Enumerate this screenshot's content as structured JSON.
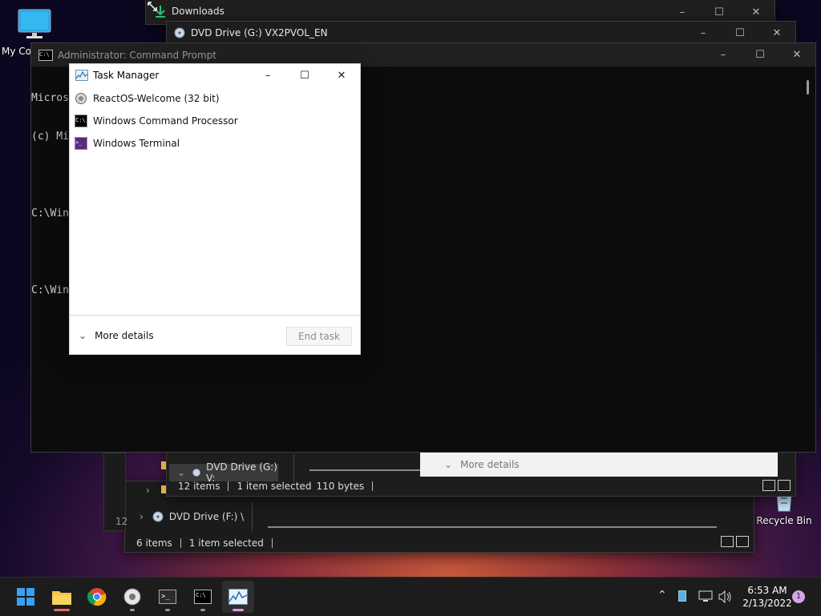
{
  "desktop": {
    "my_computer_label": "My Co",
    "recycle_bin_label": "Recycle Bin"
  },
  "downloads_window": {
    "title": "Downloads"
  },
  "dvd_g_window": {
    "title": "DVD Drive (G:) VX2PVOL_EN",
    "tree_item": "DVD Drive (G:) V:",
    "status_items": "12 items",
    "status_selected": "1 item selected",
    "status_size": "110 bytes",
    "more_details": "More details"
  },
  "back_window": {
    "tree_item": "DVD Drive (F:) \\",
    "status_items": "6 items",
    "status_selected": "1 item selected",
    "partial_count": "12"
  },
  "cmd_window": {
    "title": "Administrator: Command Prompt",
    "lines": [
      "Micros",
      "(c) Mi",
      "",
      "C:\\Win",
      "",
      "C:\\Win"
    ]
  },
  "task_manager": {
    "title": "Task Manager",
    "items": [
      {
        "label": "ReactOS-Welcome (32 bit)",
        "icon": "reactos-icon"
      },
      {
        "label": "Windows Command Processor",
        "icon": "cmd-icon"
      },
      {
        "label": "Windows Terminal",
        "icon": "terminal-icon"
      }
    ],
    "more_details": "More details",
    "end_task": "End task"
  },
  "taskbar": {
    "time": "6:53 AM",
    "date": "2/13/2022",
    "notification_count": "1",
    "apps": [
      "start-icon",
      "file-explorer-icon",
      "chrome-icon",
      "reactos-icon",
      "terminal-icon",
      "cmd-icon",
      "task-manager-icon"
    ]
  },
  "colors": {
    "accent": "#0078d4",
    "taskbar_bg": "#1c1c1c",
    "indicator": "#d89be0"
  }
}
